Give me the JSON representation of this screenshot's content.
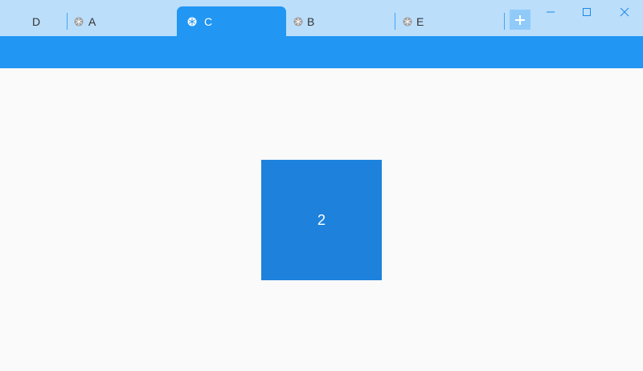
{
  "tabs": [
    {
      "label": "D",
      "has_icon": false,
      "active": false
    },
    {
      "label": "A",
      "has_icon": true,
      "icon": "snowflake-icon",
      "active": false
    },
    {
      "label": "C",
      "has_icon": true,
      "icon": "snowflake-icon",
      "active": true
    },
    {
      "label": "B",
      "has_icon": true,
      "icon": "snowflake-icon",
      "active": false
    },
    {
      "label": "E",
      "has_icon": true,
      "icon": "snowflake-icon",
      "active": false
    }
  ],
  "new_tab": {
    "icon": "plus-icon"
  },
  "window_controls": {
    "minimize": "minimize-icon",
    "maximize": "maximize-icon",
    "close": "close-icon"
  },
  "content": {
    "square_label": "2"
  },
  "colors": {
    "titlebar": "#bbdefb",
    "accent": "#2196f3",
    "square": "#1e82dc",
    "background": "#fafafa"
  }
}
